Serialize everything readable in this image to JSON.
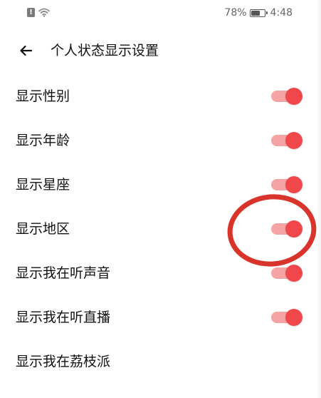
{
  "status_bar": {
    "battery": "78%",
    "time": "4:48",
    "battery_level": 0.78
  },
  "header": {
    "title": "个人状态显示设置",
    "back_icon": "arrow-left-icon"
  },
  "settings": [
    {
      "label": "显示性别",
      "enabled": true
    },
    {
      "label": "显示年龄",
      "enabled": true
    },
    {
      "label": "显示星座",
      "enabled": true
    },
    {
      "label": "显示地区",
      "enabled": true
    },
    {
      "label": "显示我在听声音",
      "enabled": true
    },
    {
      "label": "显示我在听直播",
      "enabled": true
    },
    {
      "label": "显示我在荔枝派"
    }
  ],
  "colors": {
    "accent": "#f0474b",
    "track_on": "#f6a3a3",
    "annotation": "#d9342b"
  }
}
